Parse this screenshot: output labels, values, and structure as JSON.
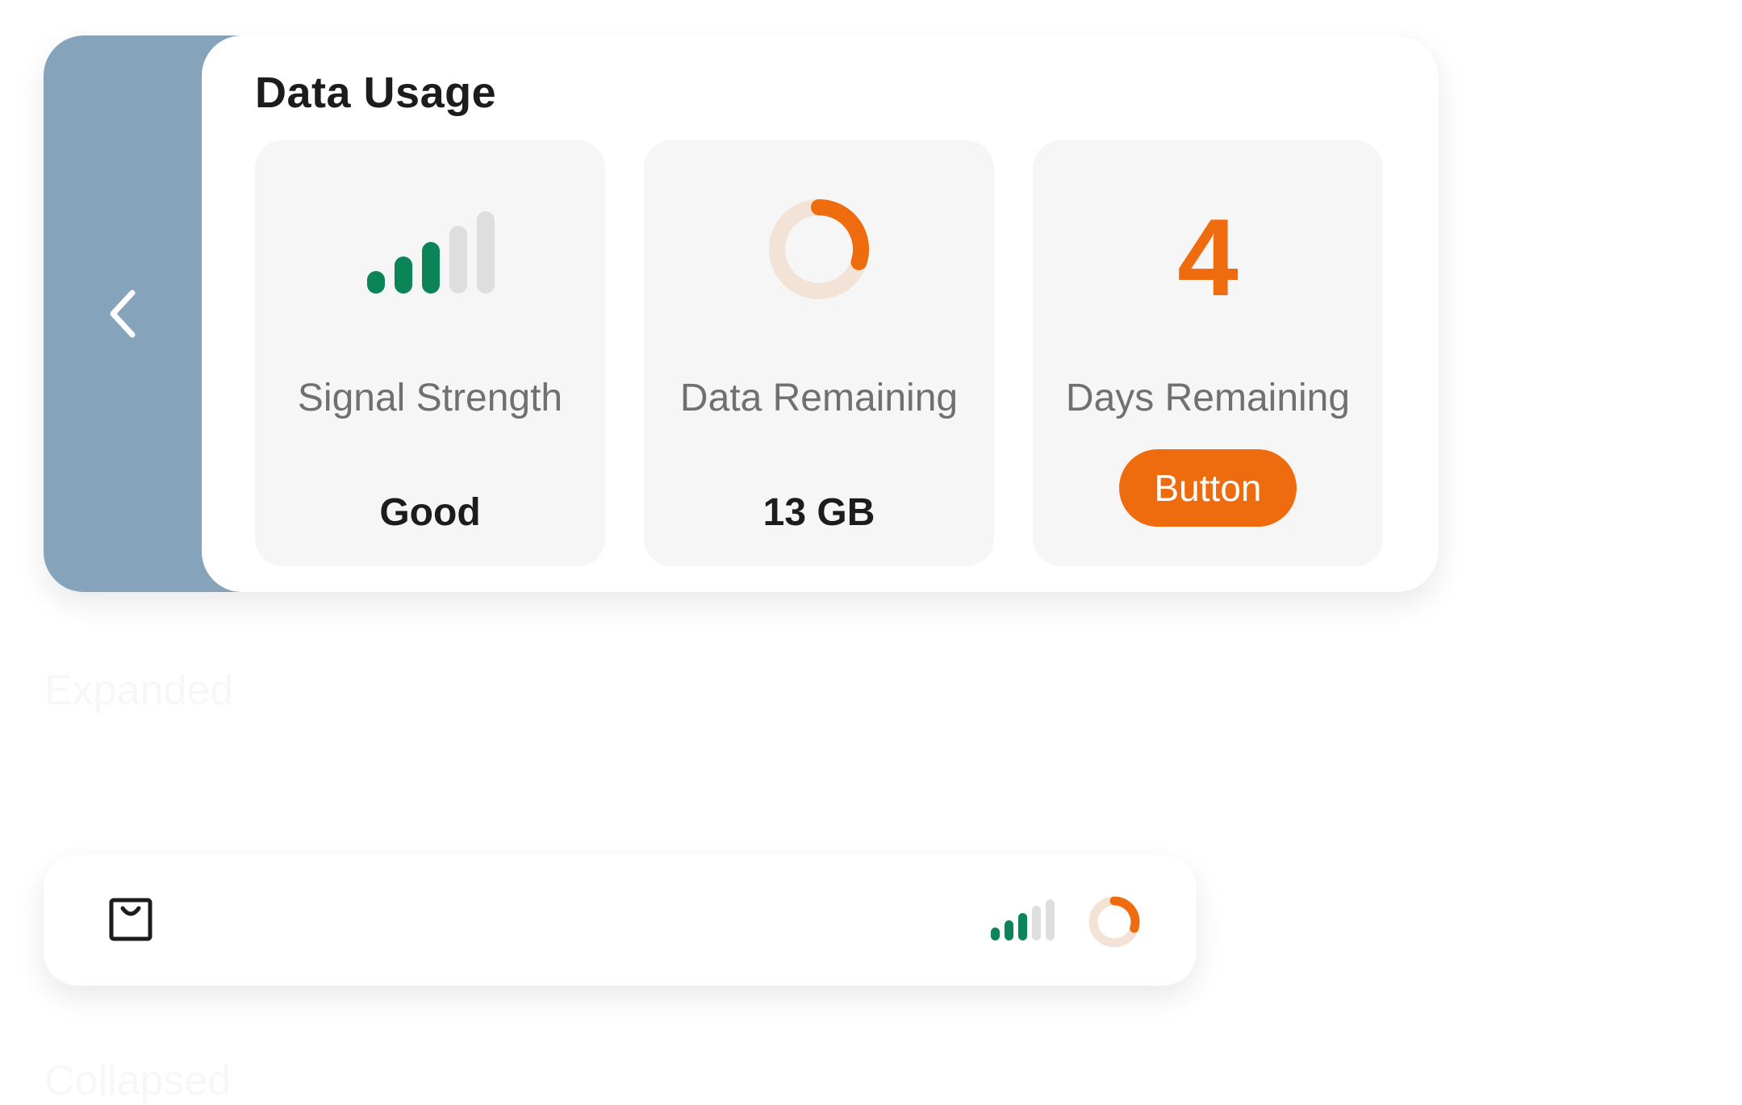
{
  "expanded": {
    "title": "Data Usage",
    "collapse_icon": "chevron-left-icon",
    "tiles": [
      {
        "icon": "signal-bars-icon",
        "label": "Signal Strength",
        "value": "Good",
        "signal_bars_active": 3,
        "signal_bars_total": 5
      },
      {
        "icon": "donut-progress-icon",
        "label": "Data Remaining",
        "value": "13 GB",
        "remaining_fraction": 0.3
      },
      {
        "number": "4",
        "label": "Days Remaining",
        "button_label": "Button"
      }
    ],
    "caption": "Expanded"
  },
  "collapsed": {
    "icon": "shopping-bag-icon",
    "signal_icon": "signal-bars-icon",
    "donut_icon": "donut-progress-icon",
    "caption": "Collapsed"
  },
  "colors": {
    "accent": "#ee6c0d",
    "signal_active": "#0b8457",
    "signal_inactive": "#dedede",
    "donut_track": "#f3e2d6",
    "handle": "#85a3ba",
    "tile_background": "#f6f6f6"
  }
}
